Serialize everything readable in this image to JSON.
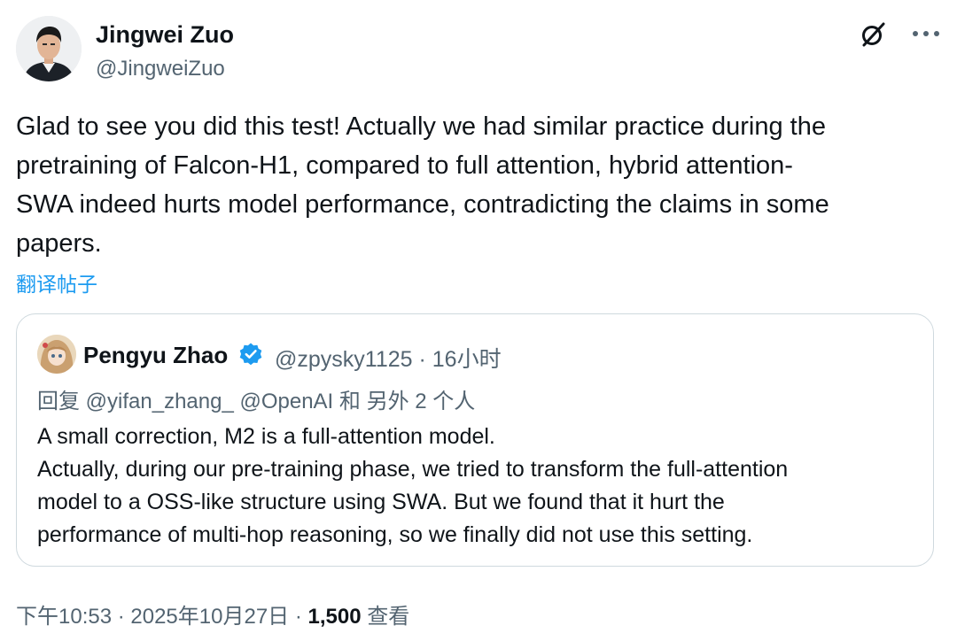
{
  "author": {
    "name": "Jingwei Zuo",
    "handle": "@JingweiZuo"
  },
  "icons": {
    "grok": "grok-icon",
    "more": "more-icon",
    "verified": "verified-badge-icon"
  },
  "tweet": {
    "text": "Glad to see you did this test! Actually we had similar practice during the\npretraining of Falcon-H1, compared to full attention, hybrid attention-\nSWA indeed hurts model performance, contradicting the claims in some\npapers.",
    "translate_label": "翻译帖子"
  },
  "quote": {
    "name": "Pengyu Zhao",
    "meta": "@zpysky1125 · 16小时",
    "reply_to": "回复 @yifan_zhang_ @OpenAI 和 另外 2 个人",
    "text": "A small correction, M2 is a full-attention model.\nActually, during our pre-training phase, we tried to transform the full-attention\nmodel to a OSS-like structure using SWA. But we found that it hurt the\nperformance of multi-hop reasoning, so we finally did not use this setting."
  },
  "footer": {
    "timestamp": "下午10:53 · 2025年10月27日 · ",
    "views_count": "1,500",
    "views_label": " 查看"
  },
  "colors": {
    "text": "#0f1419",
    "secondary": "#536471",
    "link": "#1d9bf0",
    "border": "#cfd9de"
  }
}
